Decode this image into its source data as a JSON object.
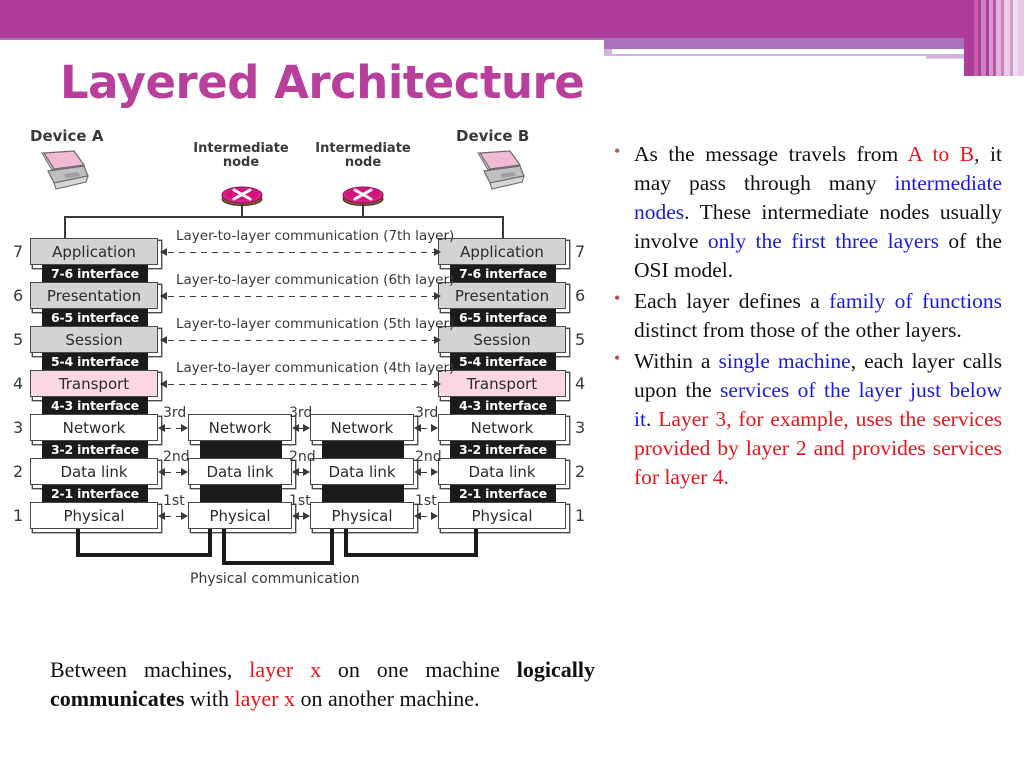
{
  "slide": {
    "title": "Layered Architecture",
    "accent_color": "#b8409c",
    "header_band_color": "#ad3d98"
  },
  "diagram": {
    "device_a_label": "Device A",
    "device_b_label": "Device B",
    "intermediate_node_label_1": "Intermediate\nnode",
    "intermediate_node_label_2": "Intermediate\nnode",
    "intermediate_node_line1": "Intermediate",
    "intermediate_node_line2": "node",
    "physical_communication_label": "Physical communication",
    "layers": [
      {
        "number": "7",
        "name": "Application",
        "color": "#d3d3d3"
      },
      {
        "number": "6",
        "name": "Presentation",
        "color": "#d3d3d3"
      },
      {
        "number": "5",
        "name": "Session",
        "color": "#d3d3d3"
      },
      {
        "number": "4",
        "name": "Transport",
        "color": "#fbd6e3"
      },
      {
        "number": "3",
        "name": "Network",
        "color": "#ffffff"
      },
      {
        "number": "2",
        "name": "Data link",
        "color": "#ffffff"
      },
      {
        "number": "1",
        "name": "Physical",
        "color": "#ffffff"
      }
    ],
    "interfaces": [
      "7-6 interface",
      "6-5 interface",
      "5-4 interface",
      "4-3 interface",
      "3-2 interface",
      "2-1 interface"
    ],
    "layer_to_layer_labels": [
      "Layer-to-layer communication (7th layer)",
      "Layer-to-layer communication (6th layer)",
      "Layer-to-layer communication (5th layer)",
      "Layer-to-layer communication (4th layer)"
    ],
    "hop_labels": [
      "3rd",
      "2nd",
      "1st"
    ],
    "intermediate_layers": [
      "Network",
      "Data link",
      "Physical"
    ]
  },
  "bullets": [
    {
      "id": "bullet-1",
      "runs": [
        {
          "text": "As the message travels from ",
          "color": "black"
        },
        {
          "text": "A to B",
          "color": "red"
        },
        {
          "text": ", it may pass through many ",
          "color": "black"
        },
        {
          "text": "intermediate nodes",
          "color": "blue"
        },
        {
          "text": ". These intermediate nodes usually involve ",
          "color": "black"
        },
        {
          "text": "only the first three layers",
          "color": "blue"
        },
        {
          "text": " of the OSI model.",
          "color": "black"
        }
      ]
    },
    {
      "id": "bullet-2",
      "runs": [
        {
          "text": "Each layer defines a ",
          "color": "black"
        },
        {
          "text": "family of functions",
          "color": "blue"
        },
        {
          "text": " distinct from those of the other layers.",
          "color": "black"
        }
      ]
    },
    {
      "id": "bullet-3",
      "runs": [
        {
          "text": "Within a ",
          "color": "black"
        },
        {
          "text": "single machine",
          "color": "blue"
        },
        {
          "text": ", each layer calls upon the ",
          "color": "black"
        },
        {
          "text": "services of the layer just below it",
          "color": "blue"
        },
        {
          "text": ". ",
          "color": "black"
        },
        {
          "text": "Layer 3, for example, uses the services provided by layer 2 and provides services for layer 4.",
          "color": "red"
        }
      ]
    }
  ],
  "caption": {
    "runs": [
      {
        "text": "Between machines, ",
        "color": "black",
        "weight": "normal"
      },
      {
        "text": "layer x",
        "color": "red",
        "weight": "normal"
      },
      {
        "text": " on one machine ",
        "color": "black",
        "weight": "normal"
      },
      {
        "text": "logically communicates",
        "color": "black",
        "weight": "bold"
      },
      {
        "text": " with ",
        "color": "black",
        "weight": "normal"
      },
      {
        "text": "layer x",
        "color": "red",
        "weight": "normal"
      },
      {
        "text": " on another machine.",
        "color": "black",
        "weight": "normal"
      }
    ]
  }
}
